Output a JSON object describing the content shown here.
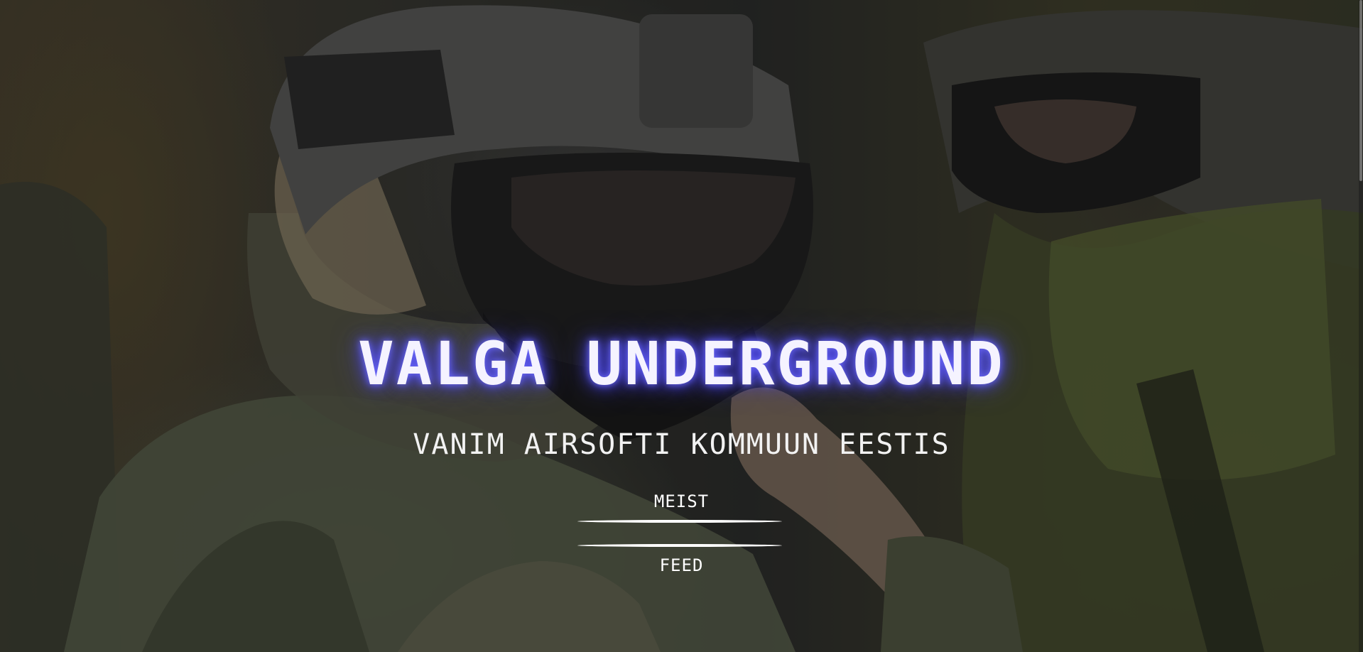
{
  "hero": {
    "title": "VALGA UNDERGROUND",
    "subtitle": "VANIM AIRSOFTI KOMMUUN EESTIS",
    "background_image": "airsoft-players-helmet-goggles"
  },
  "nav": {
    "items": [
      {
        "label": "MEIST"
      },
      {
        "label": "FEED"
      }
    ]
  },
  "colors": {
    "title_glow": "#4b47ff",
    "text": "#ffffff",
    "overlay": "rgba(0,0,0,0.30)"
  }
}
